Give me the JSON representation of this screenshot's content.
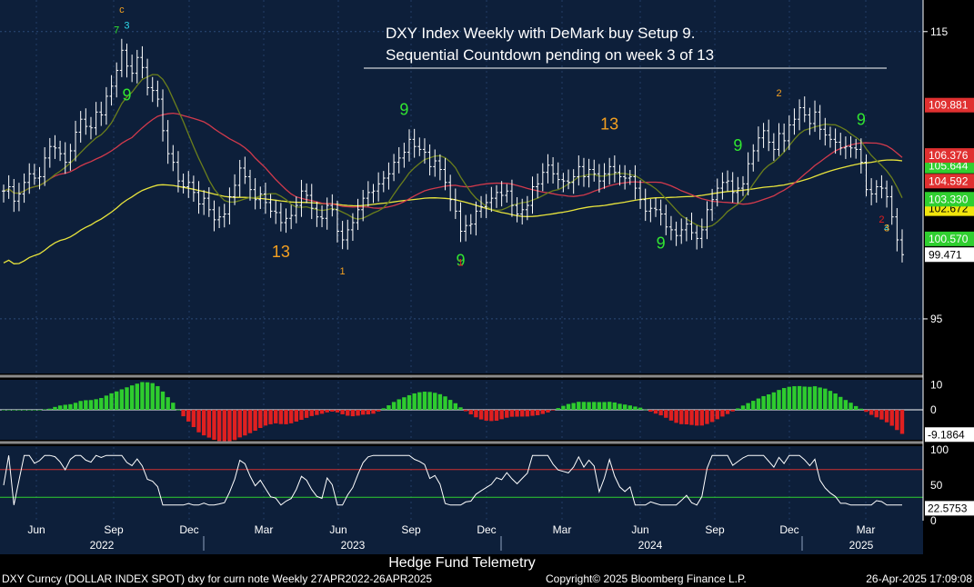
{
  "colors": {
    "background": "#0d1f3a",
    "frame": "#000000",
    "axis_text": "#ffffff",
    "grid": "#2c4a78",
    "bar": "#ffffff",
    "ma_long": "#e8e43c",
    "ma_mid": "#d23a4c",
    "ma_short": "#6b7f1c",
    "setup_buy": "#31e531",
    "setup_sell": "#e51d1d",
    "countdown": "#f4a020",
    "magenta": "#cc33cc",
    "hist_pos": "#2ecc2e",
    "hist_neg": "#e02020",
    "rsi_line": "#ffffff",
    "rsi_fill": "#8a8a8a",
    "level_green": "#2fcf2f",
    "level_red": "#d03030"
  },
  "chart_data": [
    {
      "type": "ohlc",
      "panel": "price",
      "title": "DXY Index Weekly with DeMark buy Setup 9.",
      "subtitle": "Sequential Countdown pending on week 3 of 13",
      "ylim": [
        91.2,
        117.2
      ],
      "yticks": [
        95,
        115
      ],
      "x_months": [
        "Jun",
        "Sep",
        "Dec",
        "Mar",
        "Jun",
        "Sep",
        "Dec",
        "Mar",
        "Jun",
        "Sep",
        "Dec",
        "Mar"
      ],
      "x_years": [
        "2022",
        "2023",
        "2024",
        "2025"
      ],
      "close": [
        103.9,
        104.2,
        103.2,
        103.7,
        104.5,
        105.1,
        104.8,
        104.9,
        106.2,
        107.0,
        106.9,
        106.5,
        105.9,
        106.7,
        108.0,
        108.9,
        108.4,
        108.3,
        109.4,
        109.2,
        110.5,
        111.2,
        112.3,
        113.7,
        112.6,
        112.1,
        113.2,
        112.5,
        111.1,
        110.9,
        110.3,
        108.1,
        106.5,
        105.9,
        104.6,
        104.2,
        104.5,
        103.8,
        103.0,
        103.4,
        102.6,
        101.9,
        102.1,
        102.3,
        103.5,
        104.3,
        105.5,
        104.9,
        104.0,
        103.3,
        103.7,
        103.1,
        102.5,
        102.4,
        101.7,
        102.0,
        102.2,
        102.9,
        103.9,
        103.6,
        102.7,
        102.1,
        102.0,
        102.9,
        102.6,
        101.1,
        100.5,
        101.2,
        101.7,
        102.6,
        103.4,
        103.8,
        103.9,
        104.4,
        104.8,
        105.1,
        105.9,
        106.2,
        106.6,
        107.5,
        107.0,
        106.8,
        106.6,
        105.6,
        106.0,
        105.4,
        104.5,
        103.3,
        102.5,
        101.1,
        101.5,
        101.6,
        102.5,
        102.8,
        103.1,
        103.4,
        103.8,
        103.6,
        103.9,
        102.9,
        102.3,
        102.6,
        102.9,
        104.2,
        104.4,
        105.2,
        105.7,
        105.1,
        104.7,
        104.6,
        104.5,
        104.9,
        105.6,
        104.9,
        105.4,
        105.1,
        104.6,
        105.1,
        105.6,
        105.2,
        104.9,
        104.8,
        104.9,
        104.1,
        103.3,
        102.5,
        102.7,
        102.6,
        102.3,
        101.4,
        101.2,
        100.8,
        101.2,
        101.6,
        101.0,
        100.6,
        101.2,
        102.6,
        103.3,
        104.1,
        104.5,
        104.6,
        103.8,
        104.1,
        104.4,
        105.8,
        106.7,
        107.6,
        108.1,
        107.3,
        106.8,
        107.9,
        107.4,
        108.5,
        108.9,
        109.7,
        109.2,
        108.6,
        109.4,
        108.2,
        107.8,
        107.5,
        107.3,
        106.9,
        107.0,
        106.9,
        106.8,
        105.9,
        104.0,
        103.7,
        104.2,
        104.1,
        103.5,
        102.1,
        100.5,
        99.47
      ],
      "levels": [
        {
          "color": "#2fcf2f",
          "value": 105.644,
          "label": "105.644"
        },
        {
          "color": "#e03030",
          "value": 104.592,
          "label": "104.592"
        },
        {
          "color": "#f2e50d",
          "value": 102.672,
          "label": "102.672"
        },
        {
          "color": "#e03030",
          "value": 109.881,
          "label": "109.881"
        },
        {
          "color": "#e03030",
          "value": 106.376,
          "label": "106.376"
        },
        {
          "color": "#2fcf2f",
          "value": 100.57,
          "label": "100.570"
        },
        {
          "color": "#ffffff",
          "value": 99.471,
          "label": "99.471"
        },
        {
          "color": "#2fcf2f",
          "value": 103.33,
          "label": "103.330"
        }
      ],
      "annotations": [
        {
          "i": 22,
          "text": "7",
          "color": "#31e531",
          "pos": "above"
        },
        {
          "i": 23,
          "text": "c",
          "color": "#f4a020",
          "pos": "above"
        },
        {
          "i": 24,
          "text": "3",
          "color": "#2ed8e8",
          "pos": "above"
        },
        {
          "i": 24,
          "text": "9",
          "color": "#31e531",
          "pos": "below"
        },
        {
          "i": 54,
          "text": "13",
          "color": "#f4a020",
          "pos": "below"
        },
        {
          "i": 66,
          "text": "1",
          "color": "#f4a020",
          "pos": "below"
        },
        {
          "i": 78,
          "text": "9",
          "color": "#31e531",
          "pos": "above"
        },
        {
          "i": 89,
          "text": "9",
          "color": "#31e531",
          "pos": "below"
        },
        {
          "i": 89,
          "text": "1",
          "color": "#e51d1d",
          "pos": "below"
        },
        {
          "i": 118,
          "text": "13",
          "color": "#f4a020",
          "pos": "above"
        },
        {
          "i": 128,
          "text": "9",
          "color": "#31e531",
          "pos": "below"
        },
        {
          "i": 143,
          "text": "9",
          "color": "#31e531",
          "pos": "above"
        },
        {
          "i": 151,
          "text": "2",
          "color": "#f4a020",
          "pos": "above"
        },
        {
          "i": 167,
          "text": "9",
          "color": "#31e531",
          "pos": "above"
        },
        {
          "i": 171,
          "text": "2",
          "color": "#e51d1d",
          "pos": "below"
        },
        {
          "i": 172,
          "text": "4",
          "color": "#2ed8e8",
          "pos": "below"
        },
        {
          "i": 172,
          "text": "3",
          "color": "#f4a020",
          "pos": "below"
        }
      ]
    },
    {
      "type": "bar",
      "panel": "histogram",
      "ylim": [
        -12,
        12
      ],
      "yticks": [
        10,
        0
      ],
      "last_value_label": "-9.1864"
    },
    {
      "type": "line",
      "panel": "oscillator",
      "ylim": [
        0,
        105
      ],
      "yticks": [
        100,
        50,
        0
      ],
      "reference_lines": [
        72,
        33
      ],
      "last_value_label": "22.5753"
    }
  ],
  "footer": {
    "center_label": "Hedge Fund Telemetry",
    "ticker_line": "DXY Curncy (DOLLAR INDEX SPOT) dxy for curn note  Weekly 27APR2022-26APR2025",
    "copyright": "Copyright© 2025 Bloomberg Finance L.P.",
    "timestamp": "26-Apr-2025 17:09:08"
  }
}
